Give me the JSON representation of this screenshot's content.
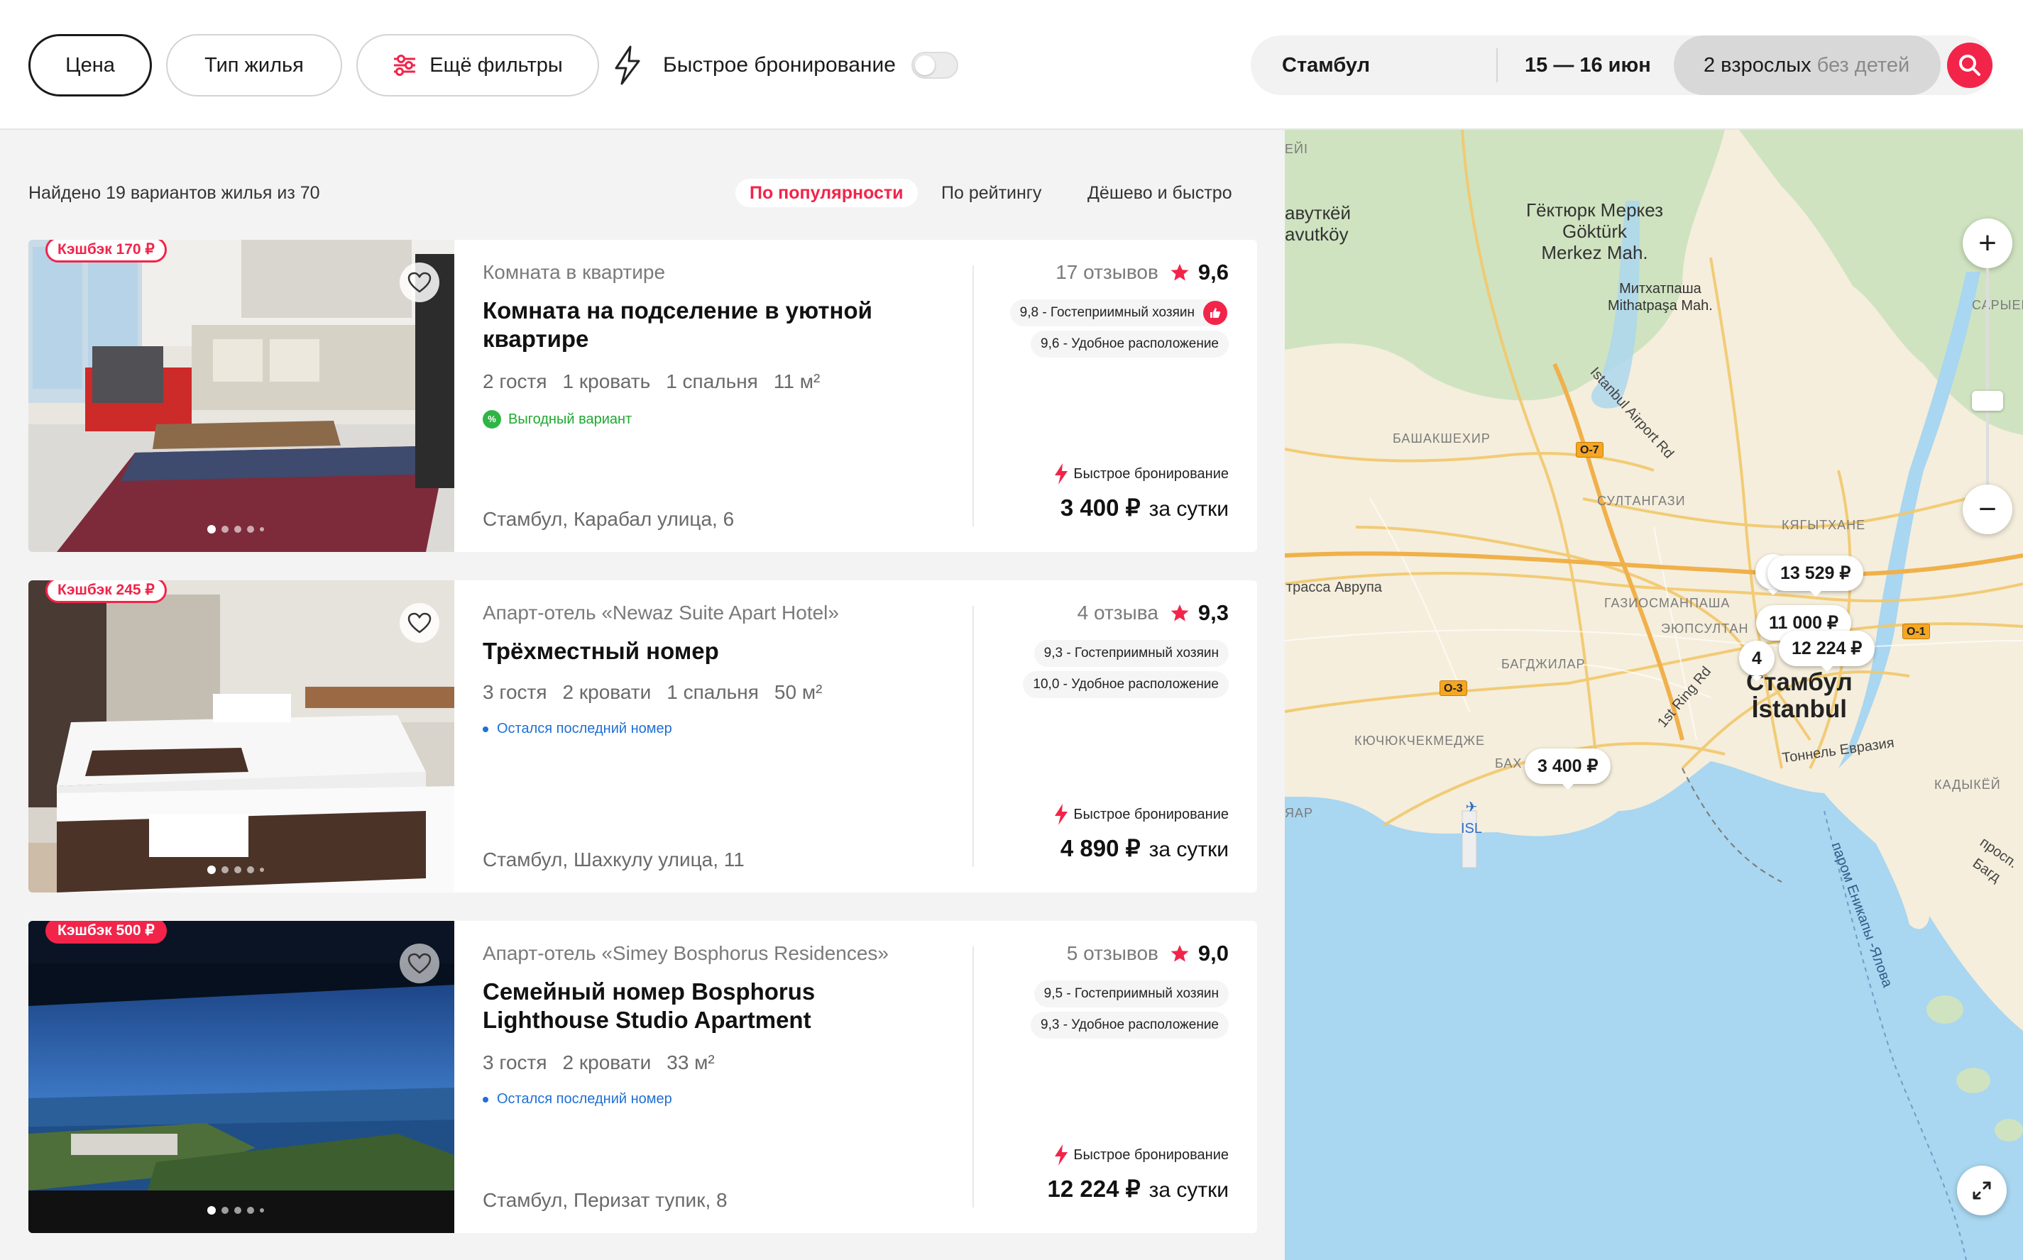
{
  "filters": {
    "price": "Цена",
    "housing_type": "Тип жилья",
    "more_filters": "Ещё фильтры",
    "fast_booking": "Быстрое бронирование"
  },
  "search": {
    "city": "Стамбул",
    "dates": "15 — 16 июн",
    "adults": "2 взрослых",
    "children": "без детей"
  },
  "results": {
    "found_text": "Найдено 19 вариантов жилья из 70",
    "sort": [
      "По популярности",
      "По рейтингу",
      "Дёшево и быстро"
    ],
    "sort_active": "По популярности"
  },
  "listings": [
    {
      "cashback": "Кэшбэк 170 ₽",
      "type": "Комната в квартире",
      "title": "Комната на подселение в уютной квартире",
      "specs": [
        "2 гостя",
        "1 кровать",
        "1 спальня",
        "11 м²"
      ],
      "note": "Выгодный вариант",
      "note_kind": "green",
      "address": "Стамбул, Карабал улица, 6",
      "reviews": "17 отзывов",
      "score": "9,6",
      "chips": [
        "9,8 - Гостеприимный хозяин",
        "9,6 - Удобное расположение"
      ],
      "fast": "Быстрое бронирование",
      "price": "3 400 ₽",
      "per": "за сутки"
    },
    {
      "cashback": "Кэшбэк 245 ₽",
      "type": "Апарт-отель «Newaz Suite Apart Hotel»",
      "title": "Трёхместный номер",
      "specs": [
        "3 гостя",
        "2 кровати",
        "1 спальня",
        "50 м²"
      ],
      "note": "Остался последний номер",
      "note_kind": "blue",
      "address": "Стамбул, Шахкулу улица, 11",
      "reviews": "4 отзыва",
      "score": "9,3",
      "chips": [
        "9,3 - Гостеприимный хозяин",
        "10,0 - Удобное расположение"
      ],
      "fast": "Быстрое бронирование",
      "price": "4 890 ₽",
      "per": "за сутки"
    },
    {
      "cashback": "Кэшбэк 500 ₽",
      "type": "Апарт-отель «Simey Bosphorus Residences»",
      "title": "Семейный номер Bosphorus Lighthouse Studio Apartment",
      "specs": [
        "3 гостя",
        "2 кровати",
        "33 м²"
      ],
      "note": "Остался последний номер",
      "note_kind": "blue",
      "address": "Стамбул, Перизат тупик, 8",
      "reviews": "5 отзывов",
      "score": "9,0",
      "chips": [
        "9,5 - Гостеприимный хозяин",
        "9,3 - Удобное расположение"
      ],
      "fast": "Быстрое бронирование",
      "price": "12 224 ₽",
      "per": "за сутки"
    }
  ],
  "map": {
    "labels": {
      "avutkoy_ru": "авуткёй",
      "avutkoy_en": "avutköy",
      "gokturk_ru": "Гёктюрк Меркез",
      "gokturk_en": "Göktürk",
      "merkez": "Merkez Mah.",
      "mithat_ru": "Митхатпаша",
      "mithat_en": "Mithatpaşa Mah.",
      "airport_rd": "Istanbul Airport Rd",
      "basak": "БАШАКШЕХИР",
      "sultan": "СУЛТАНГАЗИ",
      "kagit": "КЯГЫТХАНЕ",
      "gazi": "ГАЗИОСМАНПАША",
      "eyup": "ЭЮПСУЛТАН",
      "bagcilar": "БАГДЖИЛАР",
      "kucuk": "КЮЧЮКЧЕКМЕДЖЕ",
      "kadikoy": "КАДЫКЁЙ",
      "sariyer": "САРЫЕР",
      "trassa": "трасса Аврупа",
      "ring": "1st Ring Rd",
      "tunnel": "Тоннель Евразия",
      "ferry": "паром Еникапы -Ялова",
      "prosp": "просп. Багд",
      "isl": "ISL",
      "city_ru": "Стамбул",
      "city_en": "İstanbul",
      "eyi": "ЕЙІ",
      "bah": "БАХ",
      "ap": "ЯАР"
    },
    "shields": [
      "O-7",
      "O-3",
      "O-1"
    ],
    "markers": [
      "13 529 ₽",
      "11 000 ₽",
      "12 224 ₽",
      "3 400 ₽",
      "4",
      "1"
    ],
    "zoom_in": "+",
    "zoom_out": "−"
  },
  "colors": {
    "accent": "#f2244a",
    "green": "#1fa82f",
    "blue": "#1f6fd6"
  }
}
